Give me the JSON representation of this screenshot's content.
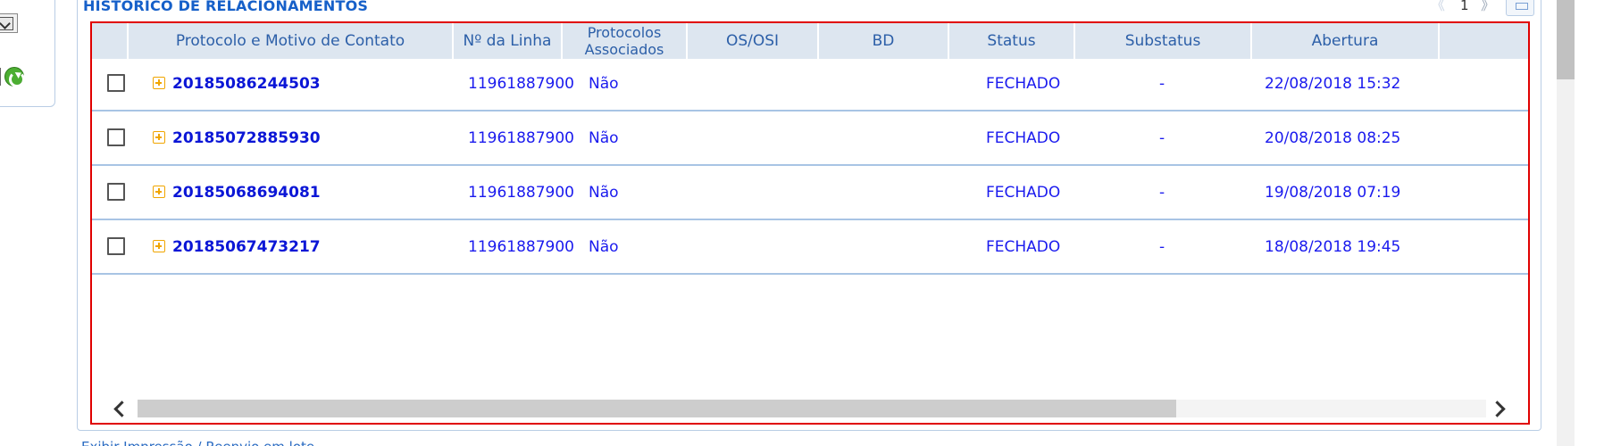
{
  "panel": {
    "title": "HISTORICO DE RELACIONAMENTOS",
    "pager": {
      "prev_icon": "chevron-left-icon",
      "page": "1",
      "next_icon": "chevron-right-icon"
    },
    "collapse_icon": "minimize-icon"
  },
  "table": {
    "columns": [
      "Protocolo e Motivo de Contato",
      "Nº da Linha",
      "Protocolos Associados",
      "OS/OSI",
      "BD",
      "Status",
      "Substatus",
      "Abertura"
    ],
    "rows": [
      {
        "protocolo": "20185086244503",
        "linha": "11961887900",
        "associados": "Não",
        "os": "",
        "bd": "",
        "status": "FECHADO",
        "substatus": "-",
        "abertura": "22/08/2018 15:32"
      },
      {
        "protocolo": "20185072885930",
        "linha": "11961887900",
        "associados": "Não",
        "os": "",
        "bd": "",
        "status": "FECHADO",
        "substatus": "-",
        "abertura": "20/08/2018 08:25"
      },
      {
        "protocolo": "20185068694081",
        "linha": "11961887900",
        "associados": "Não",
        "os": "",
        "bd": "",
        "status": "FECHADO",
        "substatus": "-",
        "abertura": "19/08/2018 07:19"
      },
      {
        "protocolo": "20185067473217",
        "linha": "11961887900",
        "associados": "Não",
        "os": "",
        "bd": "",
        "status": "FECHADO",
        "substatus": "-",
        "abertura": "18/08/2018 19:45"
      }
    ]
  },
  "footer": {
    "link": "Exibir Impressão / Reenvio em lote"
  },
  "colors": {
    "header_bg": "#dde6f0",
    "row_text": "#1a1aee",
    "grid_border": "#e00000",
    "row_divider": "#a8c4e4"
  }
}
